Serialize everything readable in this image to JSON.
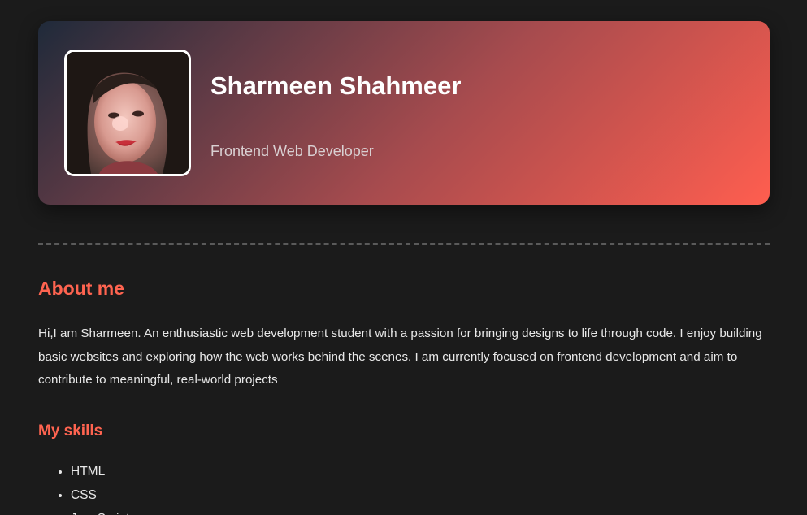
{
  "profile": {
    "name": "Sharmeen Shahmeer",
    "role": "Frontend Web Developer",
    "avatar_icon": "profile-photo"
  },
  "about": {
    "heading": "About me",
    "text": "Hi,I am Sharmeen. An enthusiastic web development student with a passion for bringing designs to life through code. I enjoy building basic websites and exploring how the web works behind the scenes. I am currently focused on frontend development and aim to contribute to meaningful, real-world projects"
  },
  "skills": {
    "heading": "My skills",
    "items": [
      "HTML",
      "CSS",
      "JavaScript"
    ]
  },
  "colors": {
    "background": "#1b1b1b",
    "accent": "#ff6450",
    "hero_gradient_start": "#1f2a3a",
    "hero_gradient_end": "#ff5e4f"
  }
}
